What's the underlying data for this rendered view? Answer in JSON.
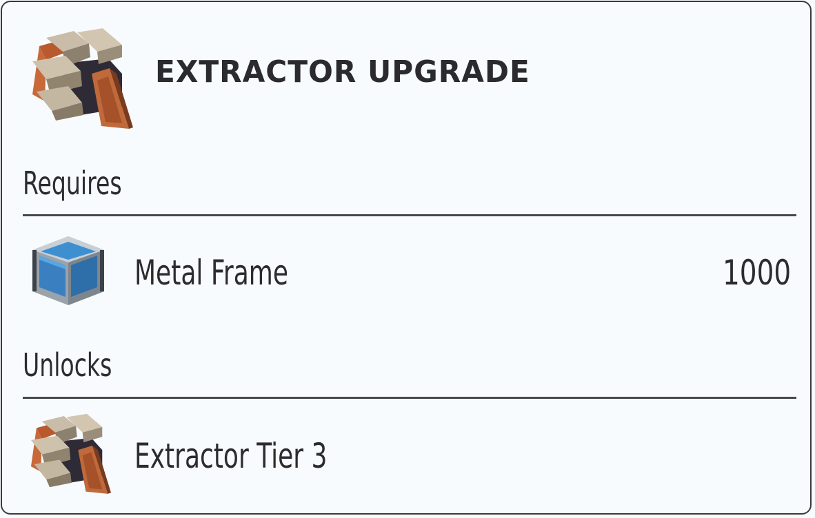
{
  "panel": {
    "title": "EXTRACTOR UPGRADE",
    "header_icon": "extractor-icon"
  },
  "requires": {
    "label": "Requires",
    "items": [
      {
        "name": "Metal Frame",
        "quantity": "1000",
        "icon": "metal-frame-icon"
      }
    ]
  },
  "unlocks": {
    "label": "Unlocks",
    "items": [
      {
        "name": "Extractor Tier 3",
        "icon": "extractor-icon"
      }
    ]
  },
  "colors": {
    "border": "#3a3a3c",
    "background": "#f7fbfe",
    "text": "#2c2c2e",
    "rule": "#47474a"
  }
}
